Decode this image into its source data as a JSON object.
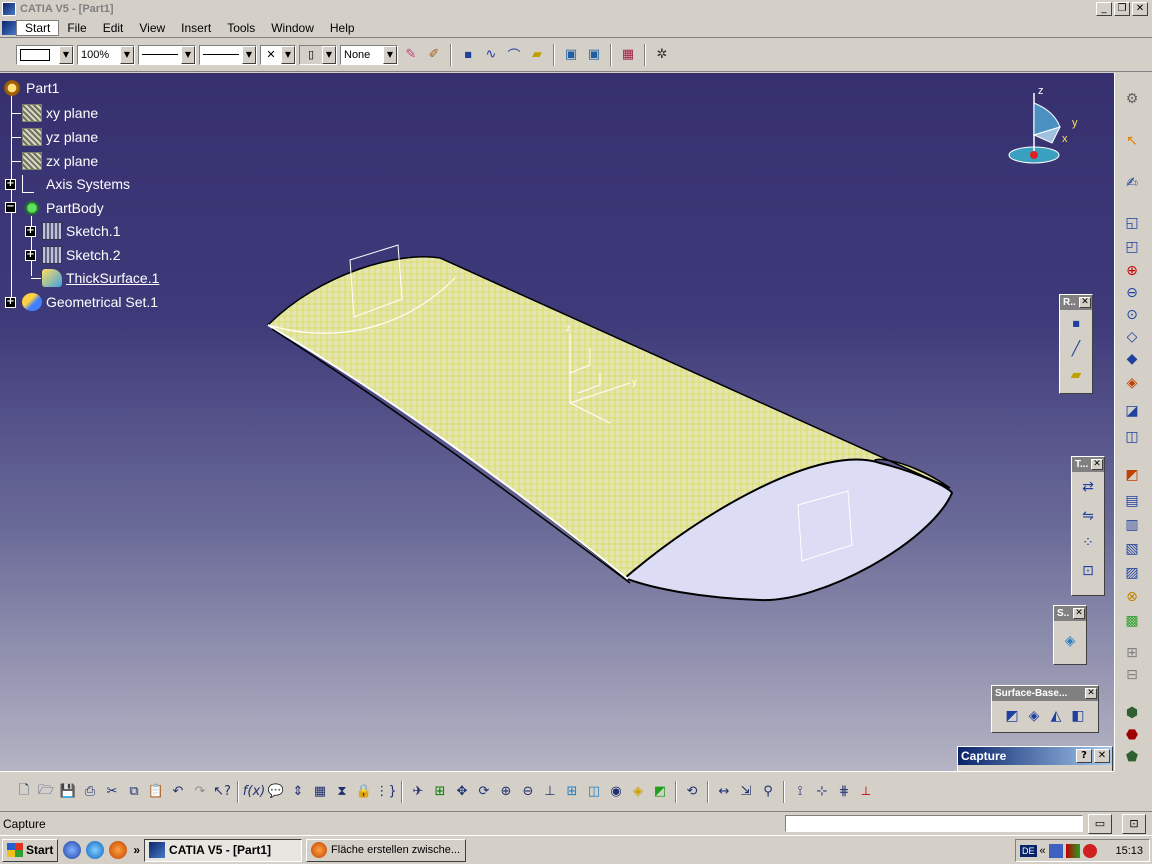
{
  "window": {
    "title": "CATIA V5 - [Part1]"
  },
  "menu": {
    "items": [
      "Start",
      "File",
      "Edit",
      "View",
      "Insert",
      "Tools",
      "Window",
      "Help"
    ]
  },
  "toolbar_top": {
    "zoom_value": "100%",
    "layer_value": "None"
  },
  "tree": {
    "root": "Part1",
    "xy_plane": "xy plane",
    "yz_plane": "yz plane",
    "zx_plane": "zx plane",
    "axis_systems": "Axis Systems",
    "partbody": "PartBody",
    "sketch1": "Sketch.1",
    "sketch2": "Sketch.2",
    "thicksurface": "ThickSurface.1",
    "geoset": "Geometrical Set.1"
  },
  "compass": {
    "z_label": "z",
    "y_label": "y",
    "x_label": "x"
  },
  "float_toolbars": {
    "r_title": "R..",
    "t_title": "T...",
    "s_title": "S..",
    "surface_title": "Surface-Base..."
  },
  "capture": {
    "title": "Capture",
    "help_label": "?",
    "close_label": "✕"
  },
  "statusbar": {
    "text": "Capture"
  },
  "taskbar": {
    "start_label": "Start",
    "task1": "CATIA V5 - [Part1]",
    "task2": "Fläche erstellen zwische...",
    "lang": "DE",
    "chevron": "«",
    "time": "15:13"
  },
  "colors": {
    "viewport_top": "#36306e",
    "viewport_bottom": "#b4b4c4",
    "surface_fill": "#e8e8b0",
    "surface_mesh": "#d8e050",
    "section_fill": "#d8d8f0"
  }
}
